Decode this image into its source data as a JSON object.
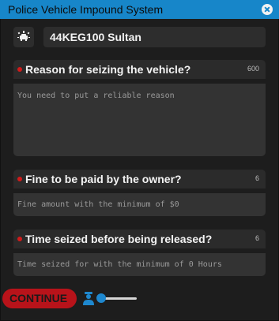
{
  "window": {
    "title": "Police Vehicle Impound System",
    "accent_color": "#1786c9"
  },
  "vehicle": {
    "icon": "car-wash-icon",
    "plate_and_model": "44KEG100 Sultan"
  },
  "reason": {
    "label": "Reason for seizing the vehicle?",
    "max_chars": "600",
    "placeholder": "You need to put a reliable reason",
    "value": ""
  },
  "fine": {
    "label": "Fine to be paid by the owner?",
    "max_chars": "6",
    "placeholder": "Fine amount with the minimum of $0",
    "value": ""
  },
  "time": {
    "label": "Time seized before being released?",
    "max_chars": "6",
    "placeholder": "Time seized for with the minimum of 0 Hours",
    "value": ""
  },
  "footer": {
    "continue_label": "CONTINUE",
    "continue_color": "#b8131a",
    "officer_icon": "officer-icon",
    "slider_level": 0
  }
}
